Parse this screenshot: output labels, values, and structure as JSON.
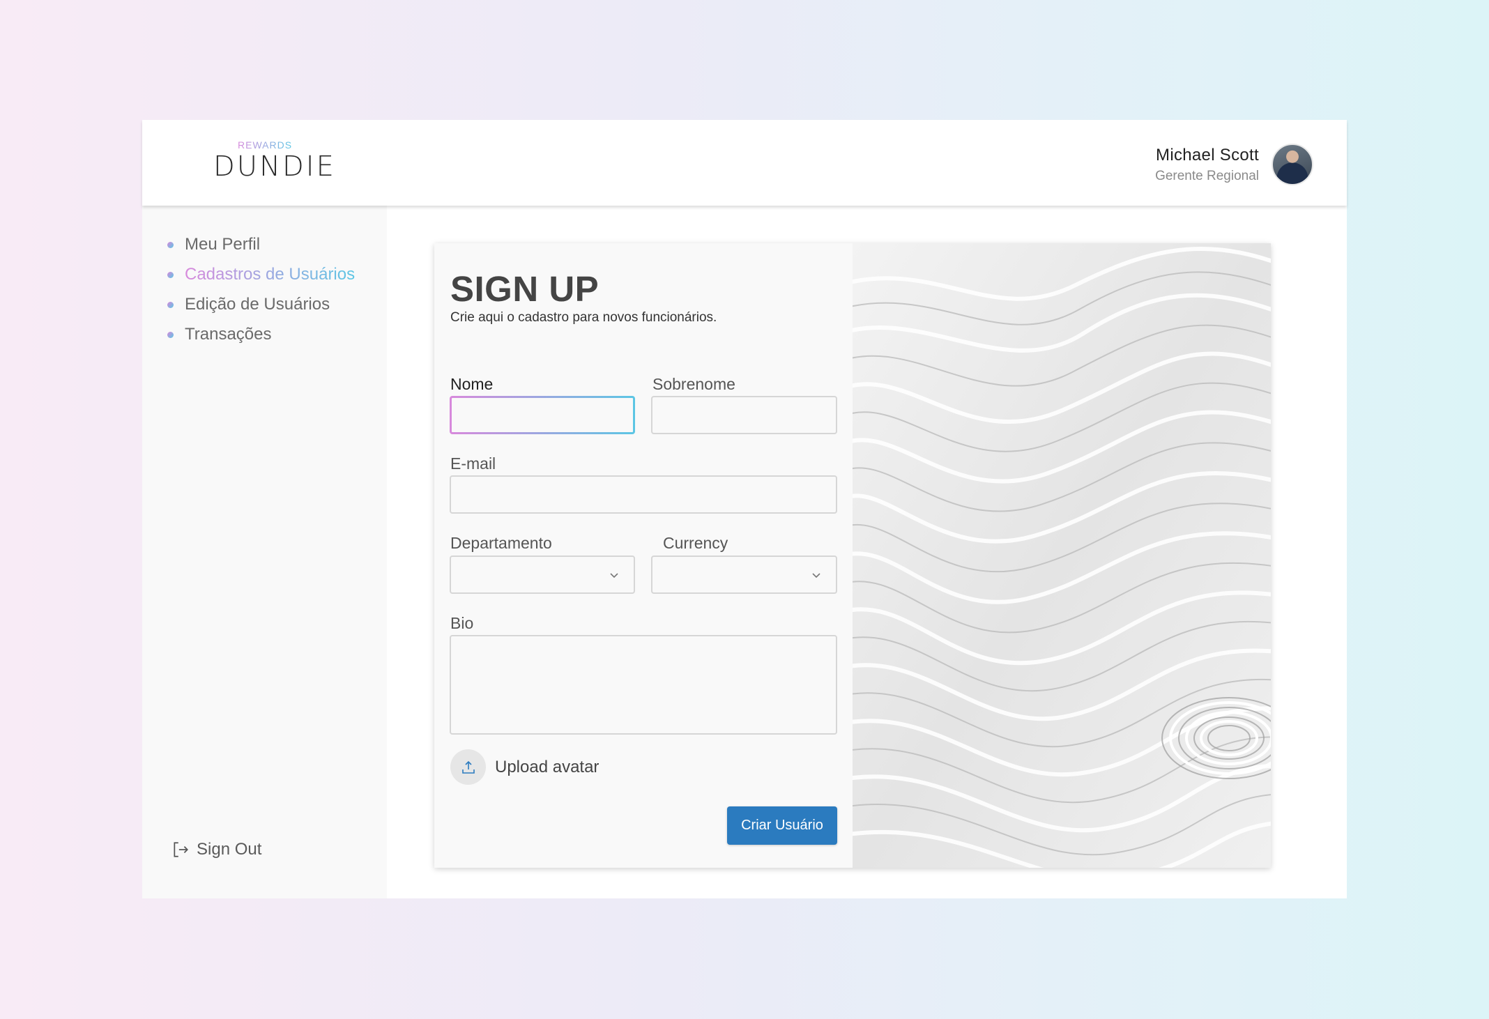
{
  "header": {
    "logo_small": "REWARDS",
    "logo_big": "DUNDIE",
    "user_name": "Michael Scott",
    "user_role": "Gerente Regional"
  },
  "sidebar": {
    "items": [
      {
        "label": "Meu Perfil",
        "active": false
      },
      {
        "label": "Cadastros de Usuários",
        "active": true
      },
      {
        "label": "Edição de Usuários",
        "active": false
      },
      {
        "label": "Transações",
        "active": false
      }
    ],
    "signout_label": "Sign Out"
  },
  "form": {
    "title": "SIGN UP",
    "subtitle": "Crie aqui o cadastro para novos funcionários.",
    "nome_label": "Nome",
    "nome_value": "",
    "sobrenome_label": "Sobrenome",
    "sobrenome_value": "",
    "email_label": "E-mail",
    "email_value": "",
    "departamento_label": "Departamento",
    "departamento_value": "",
    "currency_label": "Currency",
    "currency_value": "",
    "bio_label": "Bio",
    "bio_value": "",
    "upload_label": "Upload avatar",
    "submit_label": "Criar Usuário"
  },
  "colors": {
    "accent_gradient_start": "#d889dc",
    "accent_gradient_end": "#5cc6e4",
    "primary_button": "#2b7bbf"
  },
  "icons": {
    "upload": "upload-icon",
    "signout": "sign-out-icon",
    "select": "chevron-down-icon"
  }
}
